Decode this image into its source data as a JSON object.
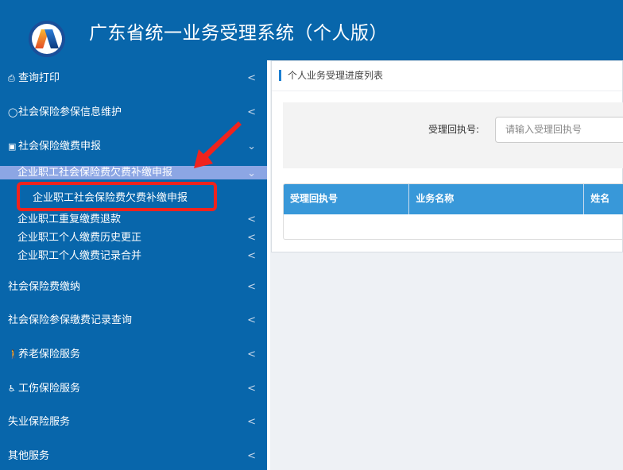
{
  "header": {
    "title": "广东省统一业务受理系统（个人版）"
  },
  "sidebar": {
    "items": [
      {
        "label": "查询打印",
        "icon": "print-icon"
      },
      {
        "label": "社会保险参保信息维护",
        "icon": "user-icon"
      },
      {
        "label": "社会保险缴费申报",
        "icon": "money-icon"
      }
    ],
    "sub_header": "企业职工社会保险费欠费补缴申报",
    "sub_sub_item": "企业职工社会保险费欠费补缴申报",
    "sub_items": [
      "企业职工重复缴费退款",
      "企业职工个人缴费历史更正",
      "企业职工个人缴费记录合并"
    ],
    "bottom_items": [
      {
        "label": "社会保险费缴纳",
        "icon": ""
      },
      {
        "label": "社会保险参保缴费记录查询",
        "icon": ""
      },
      {
        "label": "养老保险服务",
        "icon": "elderly-icon"
      },
      {
        "label": "工伤保险服务",
        "icon": "wheelchair-icon"
      },
      {
        "label": "失业保险服务",
        "icon": ""
      },
      {
        "label": "其他服务",
        "icon": ""
      }
    ]
  },
  "main": {
    "panel_title": "个人业务受理进度列表",
    "search_label": "受理回执号:",
    "search_placeholder": "请输入受理回执号",
    "columns": [
      "受理回执号",
      "业务名称",
      "姓名"
    ]
  },
  "colors": {
    "brand": "#0866ab",
    "highlight": "#8ca6e4",
    "annotation": "#f0231d",
    "table_header": "#3898d9"
  }
}
